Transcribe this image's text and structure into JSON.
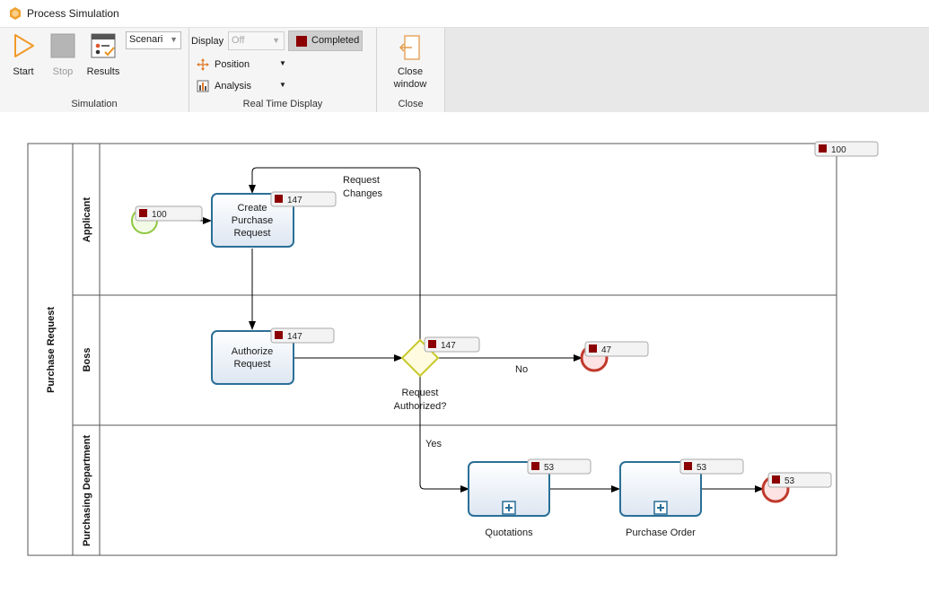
{
  "window": {
    "title": "Process Simulation"
  },
  "ribbon": {
    "start_label": "Start",
    "stop_label": "Stop",
    "results_label": "Results",
    "scenario_value": "Scenari",
    "simulation_group": "Simulation",
    "display_label": "Display",
    "display_value": "Off",
    "completed_label": "Completed",
    "position_label": "Position",
    "analysis_label": "Analysis",
    "realtime_group": "Real Time Display",
    "close_window_line1": "Close",
    "close_window_line2": "window",
    "close_group": "Close"
  },
  "diagram": {
    "pool_label": "Purchase Request",
    "lanes": {
      "applicant": "Applicant",
      "boss": "Boss",
      "purchasing": "Purchasing Department"
    },
    "tasks": {
      "create": [
        "Create",
        "Purchase",
        "Request"
      ],
      "authorize": [
        "Authorize",
        "Request"
      ],
      "quotations": "Quotations",
      "purchase_order": "Purchase Order"
    },
    "gateway": [
      "Request",
      "Authorized?"
    ],
    "flows": {
      "request_changes": [
        "Request",
        "Changes"
      ],
      "no": "No",
      "yes": "Yes"
    },
    "badges": {
      "pool": "100",
      "start": "100",
      "create": "147",
      "authorize": "147",
      "gateway": "147",
      "end_no": "47",
      "quotations": "53",
      "purchase_order": "53",
      "end_yes": "53"
    }
  },
  "colors": {
    "badge_marker": "#8b0000",
    "task_border": "#2a6f97",
    "start_event": "#8dc63f",
    "end_event": "#c0392b",
    "gateway": "#c8c82a"
  }
}
